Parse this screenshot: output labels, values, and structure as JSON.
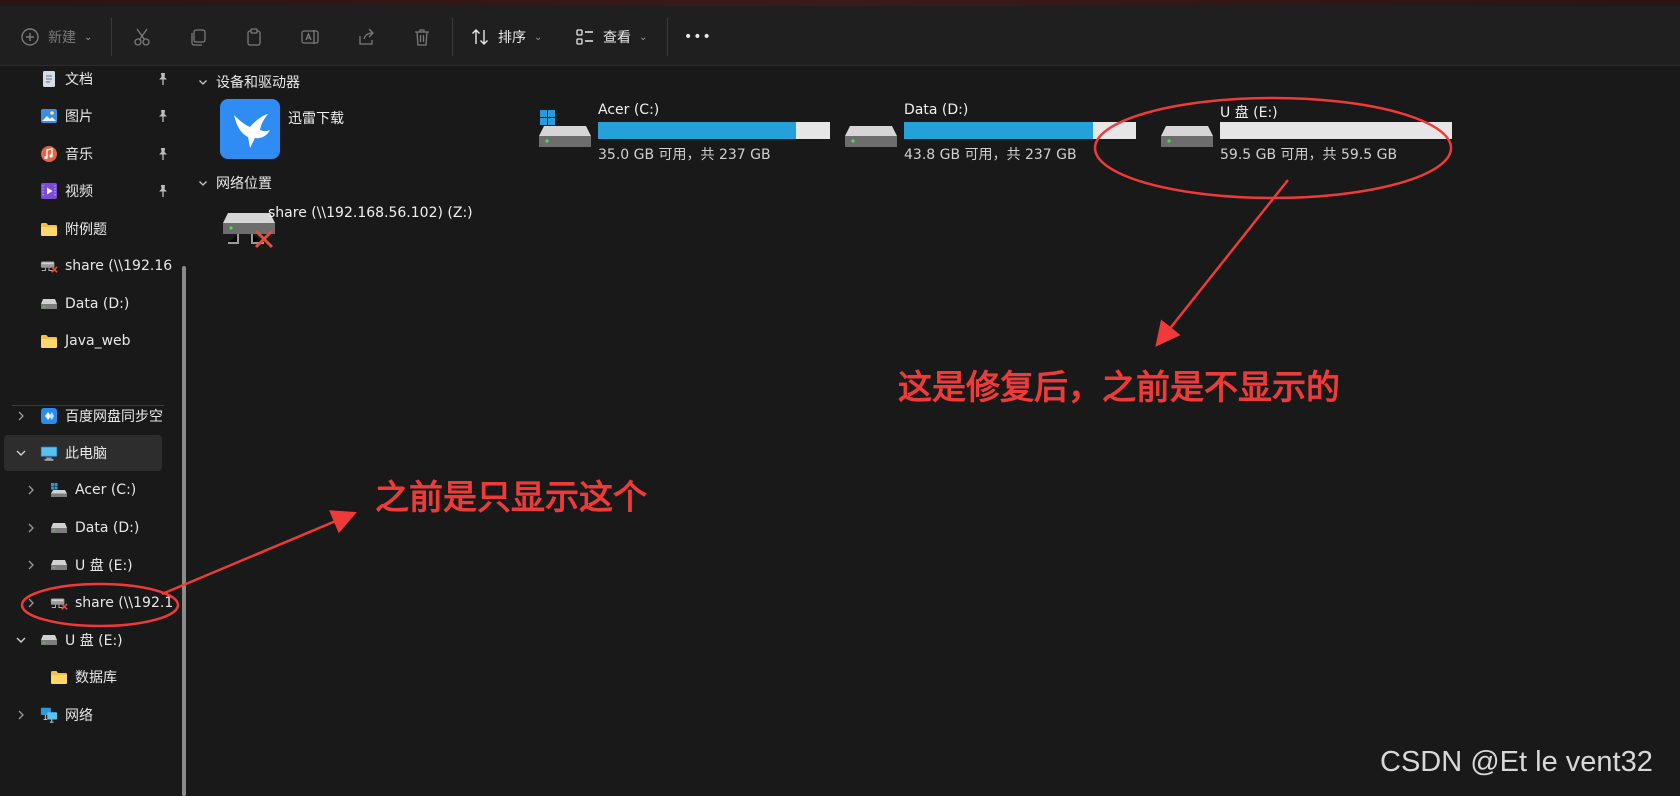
{
  "toolbar": {
    "new_label": "新建",
    "sort_label": "排序",
    "view_label": "查看",
    "more_label": "•••"
  },
  "sidebar": {
    "quick": [
      {
        "label": "文档",
        "icon": "document-icon",
        "pinned": true
      },
      {
        "label": "图片",
        "icon": "picture-icon",
        "pinned": true
      },
      {
        "label": "音乐",
        "icon": "music-icon",
        "pinned": true
      },
      {
        "label": "视频",
        "icon": "video-icon",
        "pinned": true
      },
      {
        "label": "附例题",
        "icon": "folder-icon",
        "pinned": false
      },
      {
        "label": "share (\\\\192.16",
        "icon": "network-drive-disconnected-icon",
        "pinned": false
      },
      {
        "label": "Data (D:)",
        "icon": "drive-icon",
        "pinned": false
      },
      {
        "label": "Java_web",
        "icon": "folder-icon",
        "pinned": false
      }
    ],
    "tree": [
      {
        "label": "百度网盘同步空",
        "icon": "baidu-sync-icon",
        "expanded": false
      },
      {
        "label": "此电脑",
        "icon": "computer-icon",
        "expanded": true,
        "selected": true
      },
      {
        "label": "Acer (C:)",
        "icon": "windows-drive-icon",
        "expanded": false
      },
      {
        "label": "Data (D:)",
        "icon": "drive-icon",
        "expanded": false
      },
      {
        "label": "U 盘 (E:)",
        "icon": "drive-icon",
        "expanded": false
      },
      {
        "label": "share (\\\\192.1",
        "icon": "network-drive-disconnected-icon",
        "expanded": false
      },
      {
        "label": "U 盘 (E:)",
        "icon": "drive-icon",
        "expanded": true
      },
      {
        "label": "数据库",
        "icon": "folder-icon",
        "expanded": false
      },
      {
        "label": "网络",
        "icon": "network-icon",
        "expanded": false
      }
    ]
  },
  "main": {
    "devices_header": "设备和驱动器",
    "network_header": "网络位置",
    "app": {
      "label": "迅雷下载"
    },
    "drives": [
      {
        "name": "Acer (C:)",
        "size": "35.0 GB 可用，共 237 GB",
        "used_fraction": 0.852
      },
      {
        "name": "Data (D:)",
        "size": "43.8 GB 可用，共 237 GB",
        "used_fraction": 0.815
      },
      {
        "name": "U 盘 (E:)",
        "size": "59.5 GB 可用，共 59.5 GB",
        "used_fraction": 0.0
      }
    ],
    "network_drive": {
      "name": "share (\\\\192.168.56.102) (Z:)"
    }
  },
  "annotations": {
    "right_note": "这是修复后，之前是不显示的",
    "left_note": "之前是只显示这个",
    "color": "#f03a3a"
  },
  "watermark": "CSDN @Et le vent32",
  "colors": {
    "progress": "#26a0da",
    "background": "#191919"
  }
}
